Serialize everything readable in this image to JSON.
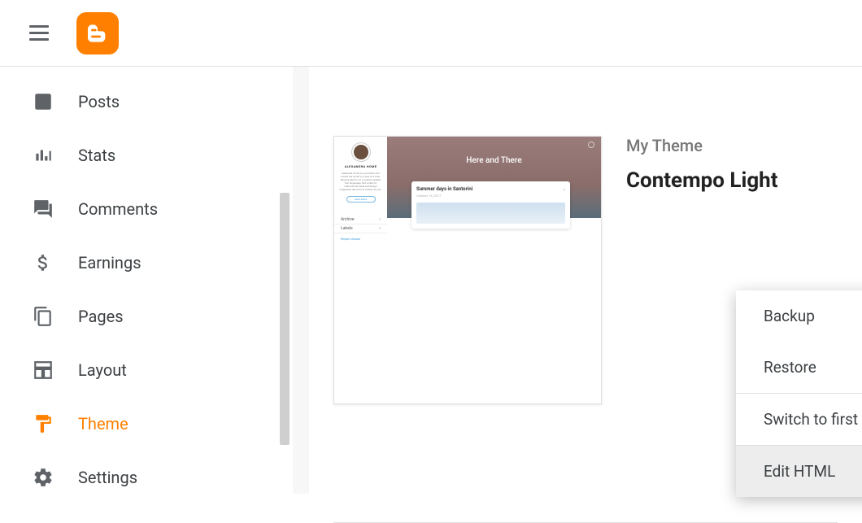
{
  "sidebar": {
    "items": [
      {
        "label": "Posts"
      },
      {
        "label": "Stats"
      },
      {
        "label": "Comments"
      },
      {
        "label": "Earnings"
      },
      {
        "label": "Pages"
      },
      {
        "label": "Layout"
      },
      {
        "label": "Theme"
      },
      {
        "label": "Settings"
      }
    ]
  },
  "theme": {
    "section_label": "My Theme",
    "name": "Contempo Light",
    "preview": {
      "blog_title": "Here and There",
      "author": "ALEXANDRA HOME",
      "bio": "Alexandra Home is a journalist who travels the world for a year at a time. She has been to 47 countries, speaks four languages, and writes for international travel and design magazines about food, culture, art, etc.",
      "cta": "Learn More",
      "section_archive": "Archive",
      "section_labels": "Labels",
      "report": "Report Abuse",
      "post_title": "Summer days in Santorini",
      "post_date": "October 16, 2017"
    }
  },
  "menu": {
    "items": [
      {
        "label": "Backup"
      },
      {
        "label": "Restore"
      },
      {
        "label": "Switch to first generation Classic theme"
      },
      {
        "label": "Edit HTML"
      }
    ]
  }
}
